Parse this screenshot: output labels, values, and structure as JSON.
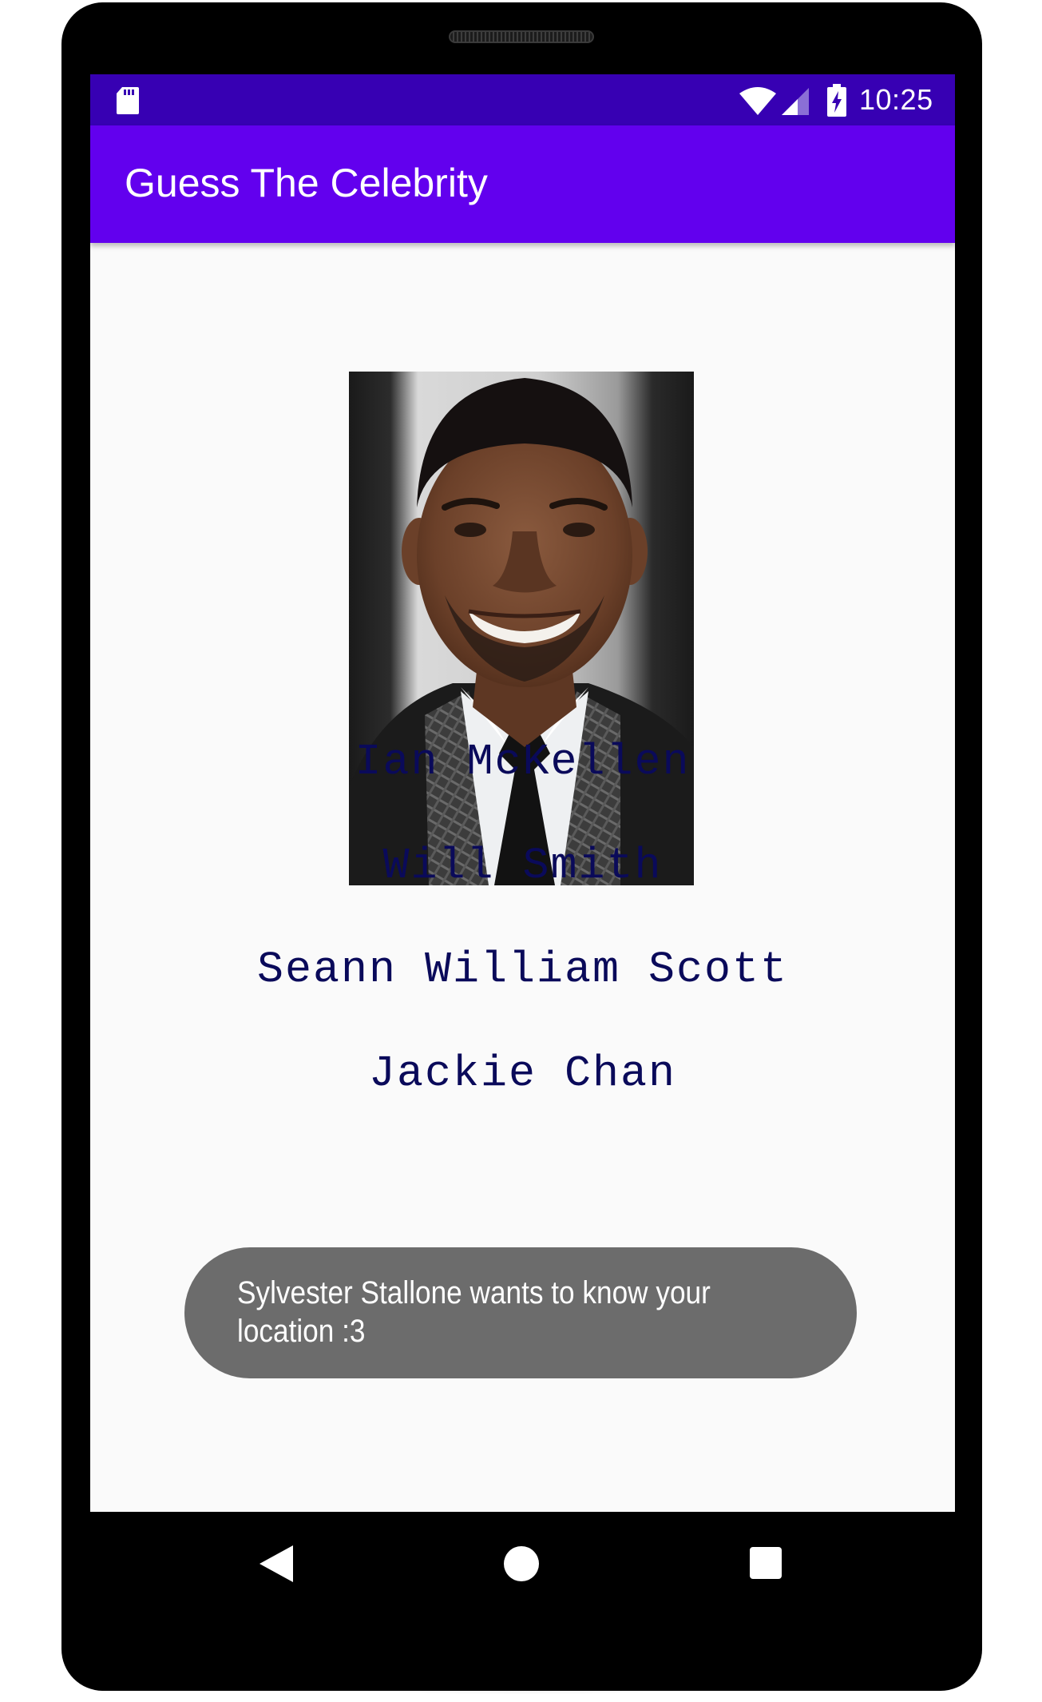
{
  "status_bar": {
    "time": "10:25",
    "icons": [
      "sd-card-icon",
      "wifi-icon",
      "cell-signal-icon",
      "battery-charging-icon"
    ]
  },
  "app_bar": {
    "title": "Guess The Celebrity"
  },
  "main": {
    "photo": {
      "icon": "celebrity-portrait-image"
    },
    "options": [
      {
        "label": "Ian McKellen"
      },
      {
        "label": "Will Smith"
      },
      {
        "label": "Seann William Scott"
      },
      {
        "label": "Jackie Chan"
      }
    ]
  },
  "toast": {
    "message": "Sylvester Stallone wants to know your location :3"
  },
  "nav_bar": {
    "icons": [
      "back-icon",
      "home-icon",
      "recents-icon"
    ]
  },
  "colors": {
    "status_bar": "#3700b3",
    "app_bar": "#6200ee",
    "screen_background": "#fafafa",
    "option_text": "#0a0a5a",
    "toast_background": "#636363"
  }
}
